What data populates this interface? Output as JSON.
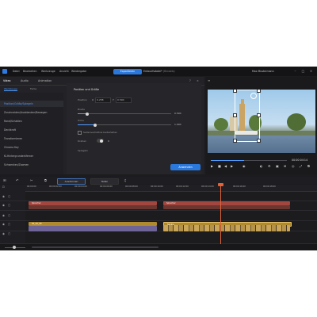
{
  "titlebar": {
    "menu": [
      "Datei",
      "Bearbeiten",
      "Werkzeuge",
      "Ansicht",
      "Wiedergabe"
    ],
    "primary_button": "Exportieren",
    "project_title": "Entwurfsdatei*",
    "project_note": "(Hinweis)",
    "user": "Max Mustermann"
  },
  "panel": {
    "tabs": [
      "Video",
      "Audio",
      "Animation"
    ],
    "subtabs": [
      "Werkzeuge",
      "Farbe"
    ],
    "side_items": [
      "Position/Größe/Spiegeln",
      "Zuschneiden/Ausblenden/Bewegen",
      "Rand/Schatten",
      "Deckkraft",
      "Transformieren",
      "Chroma Key",
      "KI-Hintergrundentferner",
      "Schwenken/Zoomen"
    ],
    "section_title": "Position und Größe",
    "position_label": "Position",
    "position_x": "0.258",
    "position_y": "0.500",
    "width_label": "Breite",
    "width_value": "0.500",
    "height_label": "Höhe",
    "height_value": "1.000",
    "aspect_label": "Seitenverhältnis beibehalten",
    "rotation_label": "Drehen",
    "rotation_value": "0",
    "mirror_label": "Spiegeln",
    "apply_button": "Anwenden"
  },
  "preview": {
    "timecode": "00:00:04:14"
  },
  "timeline": {
    "toolbar_buttons": [
      "Ausdünnen",
      "Teilen"
    ],
    "ruler": [
      "00:00:00",
      "00:00:02:00",
      "00:00:04:00",
      "00:00:06:00",
      "00:00:08:00",
      "00:00:10:00",
      "00:00:12:00",
      "00:00:14:00",
      "00:00:16:00",
      "00:00:18:00"
    ],
    "clips": {
      "text_left": "Sprecher",
      "text_right": "Sprecher",
      "video_left": "00_00_08",
      "video_right": "Sevilla"
    }
  },
  "colors": {
    "accent": "#2b78dd",
    "playhead": "#e0633a",
    "text_clip": "#a2463f",
    "video_clip": "#b08a2e"
  }
}
